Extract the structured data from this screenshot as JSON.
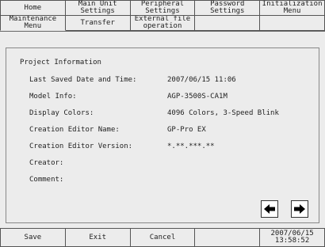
{
  "tabs_row1": [
    "Home",
    "Main Unit\nSettings",
    "Peripheral\nSettings",
    "Password\nSettings",
    "Initialization\nMenu"
  ],
  "tabs_row2": [
    "Maintenance\nMenu",
    "Transfer",
    "External file\noperation",
    "",
    ""
  ],
  "panel": {
    "title": "Project Information",
    "rows": [
      {
        "label": "Last Saved Date and Time:",
        "value": "2007/06/15 11:06"
      },
      {
        "label": "Model Info:",
        "value": "AGP-3500S-CA1M"
      },
      {
        "label": "Display Colors:",
        "value": "4096 Colors, 3-Speed Blink"
      },
      {
        "label": "Creation Editor Name:",
        "value": "GP-Pro EX"
      },
      {
        "label": "Creation Editor Version:",
        "value": "*.**.***.**"
      },
      {
        "label": "Creator:",
        "value": ""
      },
      {
        "label": "Comment:",
        "value": ""
      }
    ]
  },
  "nav": {
    "prev_icon": "arrow-left-icon",
    "next_icon": "arrow-right-icon"
  },
  "bottom": {
    "save": "Save",
    "exit": "Exit",
    "cancel": "Cancel",
    "date": "2007/06/15",
    "time": "13:58:52"
  }
}
